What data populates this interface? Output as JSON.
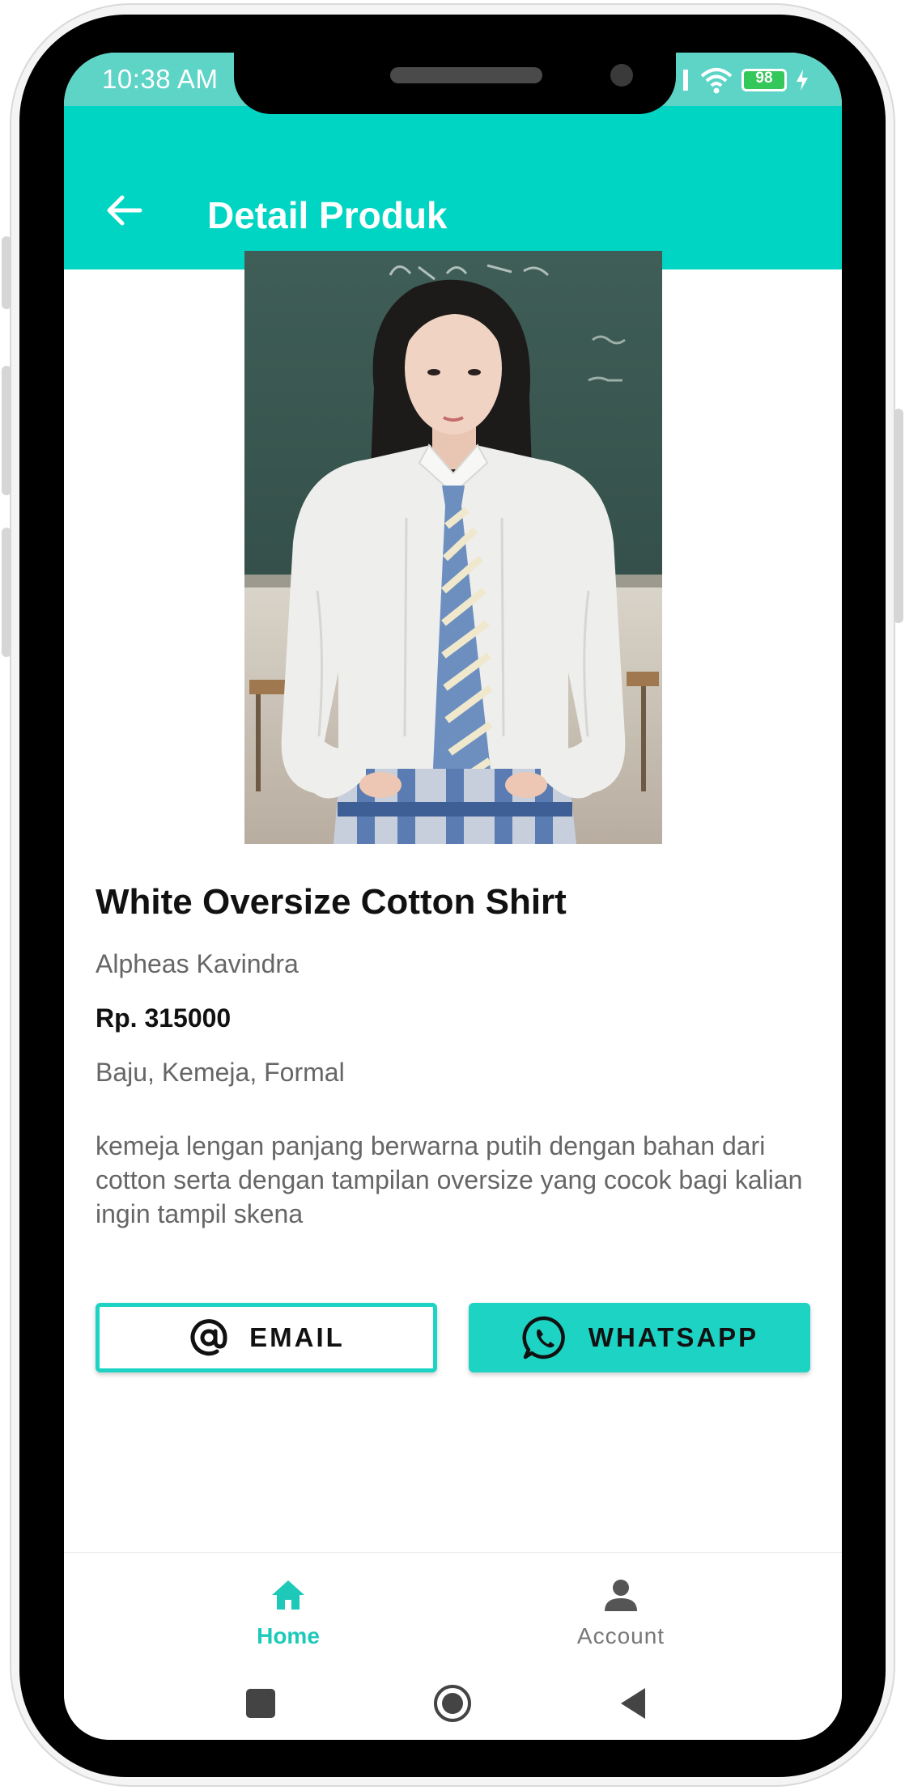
{
  "status_bar": {
    "time": "10:38 AM",
    "battery": "98"
  },
  "app_bar": {
    "title": "Detail Produk"
  },
  "product": {
    "name": "White Oversize Cotton Shirt",
    "seller": "Alpheas Kavindra",
    "price": "Rp. 315000",
    "tags": "Baju, Kemeja, Formal",
    "description": "kemeja lengan panjang berwarna putih dengan bahan dari cotton serta dengan tampilan oversize yang cocok bagi kalian ingin tampil skena"
  },
  "actions": {
    "email_label": "EMAIL",
    "whatsapp_label": "WHATSAPP"
  },
  "bottom_nav": {
    "home_label": "Home",
    "account_label": "Account"
  },
  "colors": {
    "accent": "#00d5c3",
    "status_bar": "#5ed4c7",
    "nav_active": "#1ec9ba"
  }
}
